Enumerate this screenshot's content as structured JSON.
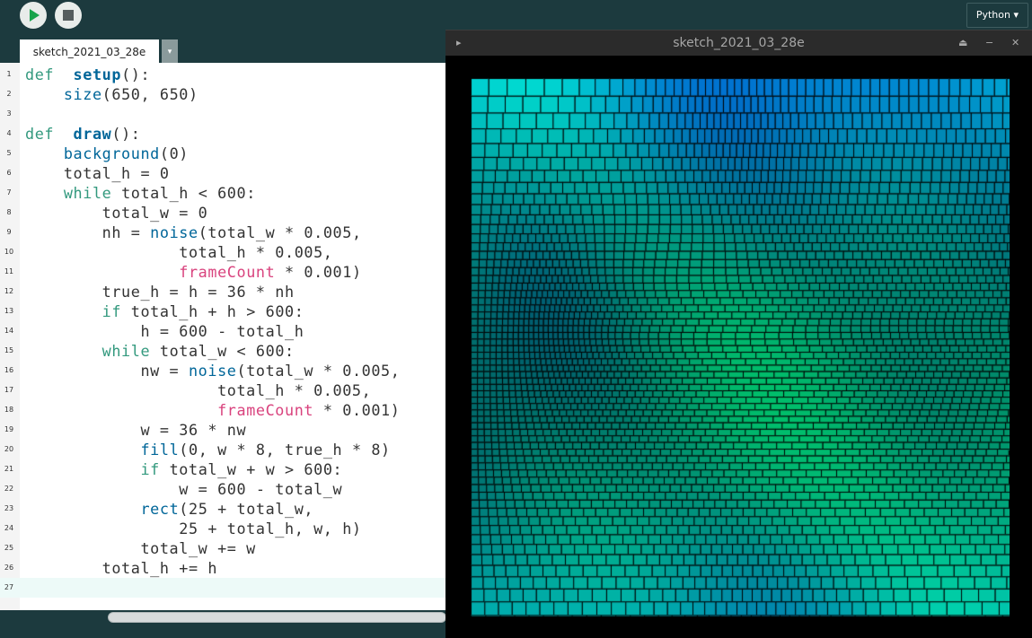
{
  "toolbar": {
    "run_icon": "play-icon",
    "stop_icon": "stop-icon",
    "mode_label": "Python ▾"
  },
  "editor": {
    "tab_label": "sketch_2021_03_28e",
    "tab_menu_icon": "▾",
    "current_line": 27,
    "lines": [
      [
        [
          "kw",
          "def"
        ],
        [
          "",
          "  "
        ],
        [
          "def",
          "setup"
        ],
        [
          "",
          "():"
        ]
      ],
      [
        [
          "",
          "    "
        ],
        [
          "fn",
          "size"
        ],
        [
          "",
          "(650, 650)"
        ]
      ],
      [],
      [
        [
          "kw",
          "def"
        ],
        [
          "",
          "  "
        ],
        [
          "def",
          "draw"
        ],
        [
          "",
          "():"
        ]
      ],
      [
        [
          "",
          "    "
        ],
        [
          "fn",
          "background"
        ],
        [
          "",
          "(0)"
        ]
      ],
      [
        [
          "",
          "    total_h = 0"
        ]
      ],
      [
        [
          "",
          "    "
        ],
        [
          "kw",
          "while"
        ],
        [
          "",
          " total_h < 600:"
        ]
      ],
      [
        [
          "",
          "        total_w = 0"
        ]
      ],
      [
        [
          "",
          "        nh = "
        ],
        [
          "fn",
          "noise"
        ],
        [
          "",
          "(total_w * 0.005,"
        ]
      ],
      [
        [
          "",
          "                total_h * 0.005,"
        ]
      ],
      [
        [
          "",
          "                "
        ],
        [
          "var",
          "frameCount"
        ],
        [
          "",
          " * 0.001)"
        ]
      ],
      [
        [
          "",
          "        true_h = h = 36 * nh"
        ]
      ],
      [
        [
          "",
          "        "
        ],
        [
          "kw",
          "if"
        ],
        [
          "",
          " total_h + h > 600:"
        ]
      ],
      [
        [
          "",
          "            h = 600 - total_h"
        ]
      ],
      [
        [
          "",
          "        "
        ],
        [
          "kw",
          "while"
        ],
        [
          "",
          " total_w < 600:"
        ]
      ],
      [
        [
          "",
          "            nw = "
        ],
        [
          "fn",
          "noise"
        ],
        [
          "",
          "(total_w * 0.005,"
        ]
      ],
      [
        [
          "",
          "                    total_h * 0.005,"
        ]
      ],
      [
        [
          "",
          "                    "
        ],
        [
          "var",
          "frameCount"
        ],
        [
          "",
          " * 0.001)"
        ]
      ],
      [
        [
          "",
          "            w = 36 * nw"
        ]
      ],
      [
        [
          "",
          "            "
        ],
        [
          "fn",
          "fill"
        ],
        [
          "",
          "(0, w * 8, true_h * 8)"
        ]
      ],
      [
        [
          "",
          "            "
        ],
        [
          "kw",
          "if"
        ],
        [
          "",
          " total_w + w > 600:"
        ]
      ],
      [
        [
          "",
          "                w = 600 - total_w"
        ]
      ],
      [
        [
          "",
          "            "
        ],
        [
          "fn",
          "rect"
        ],
        [
          "",
          "(25 + total_w,"
        ]
      ],
      [
        [
          "",
          "                25 + total_h, w, h)"
        ]
      ],
      [
        [
          "",
          "            total_w += w"
        ]
      ],
      [
        [
          "",
          "        total_h += h"
        ]
      ],
      []
    ]
  },
  "sketch_window": {
    "title": "sketch_2021_03_28e",
    "menu_icon": "▸",
    "collapse_icon": "⏏",
    "minimize_icon": "−",
    "close_icon": "✕"
  },
  "colors": {
    "keyword": "#33997e",
    "function": "#006699",
    "variable": "#d9437e",
    "code": "#333333",
    "toolbar_bg": "#1c3a3e",
    "sketch_bg": "#000000"
  }
}
